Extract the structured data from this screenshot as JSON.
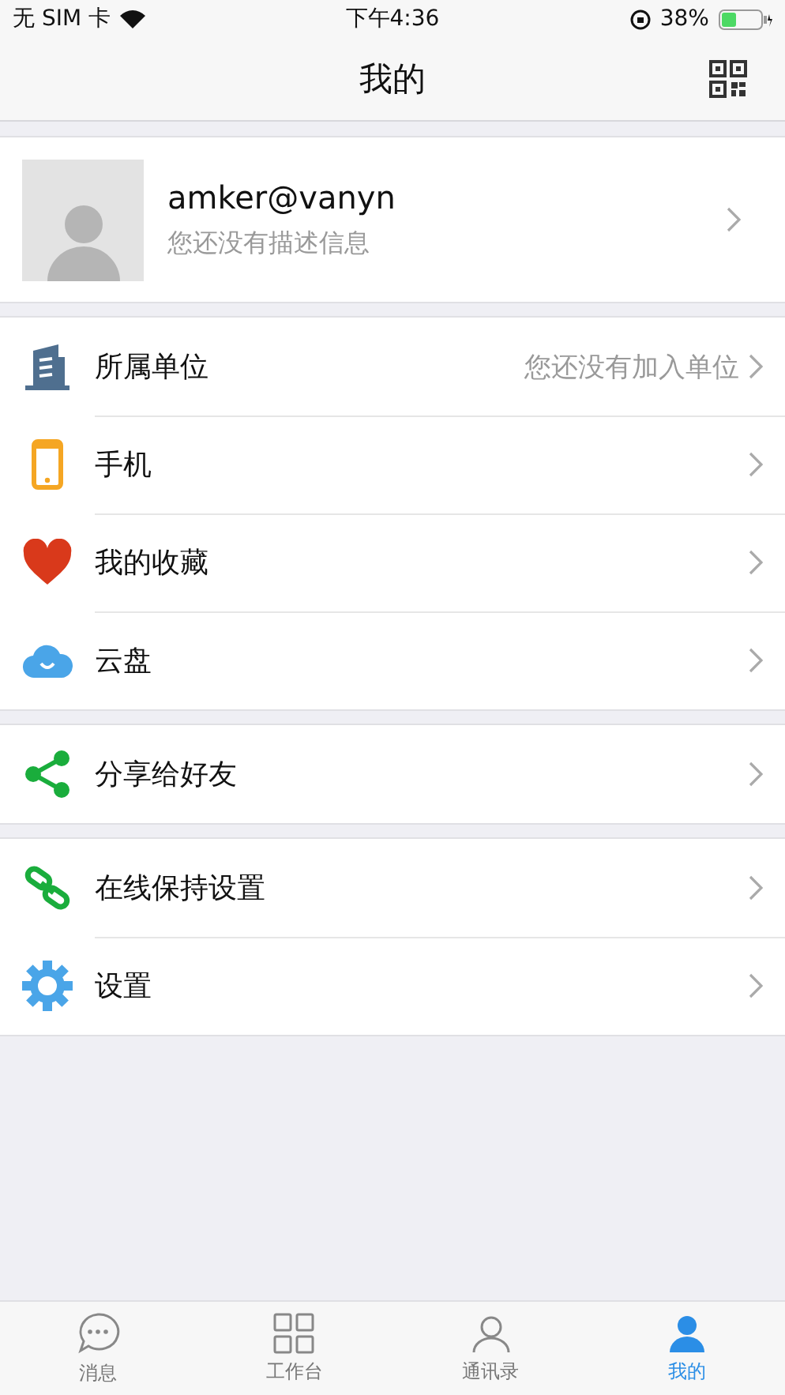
{
  "status_bar": {
    "carrier": "无 SIM 卡",
    "time": "下午4:36",
    "battery": "38%"
  },
  "nav_bar": {
    "title": "我的"
  },
  "profile": {
    "name": "amker@vanyn",
    "description": "您还没有描述信息"
  },
  "groups": [
    {
      "items": [
        {
          "label": "所属单位",
          "value": "您还没有加入单位"
        },
        {
          "label": "手机"
        },
        {
          "label": "我的收藏"
        },
        {
          "label": "云盘"
        }
      ]
    },
    {
      "items": [
        {
          "label": "分享给好友"
        }
      ]
    },
    {
      "items": [
        {
          "label": "在线保持设置"
        },
        {
          "label": "设置"
        }
      ]
    }
  ],
  "tab_bar": [
    {
      "label": "消息",
      "selected": false
    },
    {
      "label": "工作台",
      "selected": false
    },
    {
      "label": "通讯录",
      "selected": false
    },
    {
      "label": "我的",
      "selected": true
    }
  ]
}
